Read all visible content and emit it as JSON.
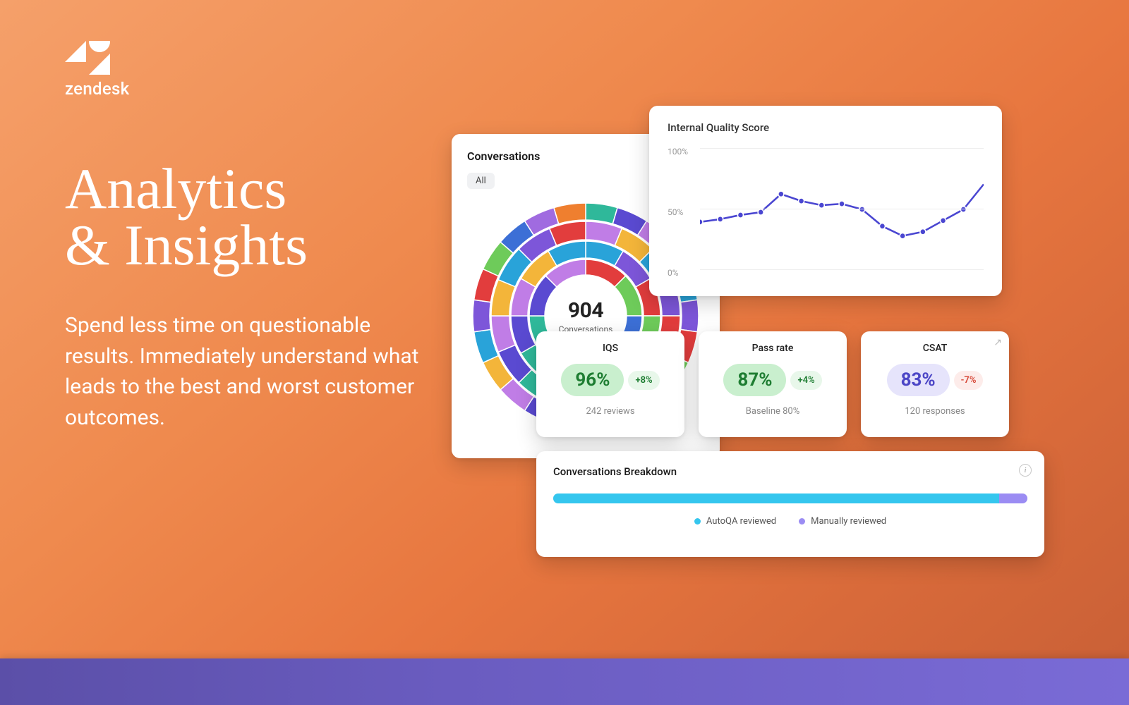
{
  "brand": {
    "name": "zendesk"
  },
  "hero": {
    "title_line1": "Analytics",
    "title_line2": "& Insights",
    "subhead": "Spend less time on questionable results. Immediately understand what leads to the best and worst customer outcomes."
  },
  "conversations_card": {
    "title": "Conversations",
    "filter_chip": "All",
    "center_value": "904",
    "center_label": "Conversations"
  },
  "iqs_card": {
    "title": "Internal Quality Score"
  },
  "kpis": {
    "iqs": {
      "title": "IQS",
      "value": "96%",
      "delta": "+8%",
      "sub": "242 reviews"
    },
    "pass": {
      "title": "Pass rate",
      "value": "87%",
      "delta": "+4%",
      "sub": "Baseline 80%"
    },
    "csat": {
      "title": "CSAT",
      "value": "83%",
      "delta": "-7%",
      "sub": "120 responses"
    }
  },
  "breakdown_card": {
    "title": "Conversations Breakdown",
    "legend_auto": "AutoQA reviewed",
    "legend_manual": "Manually reviewed"
  },
  "colors": {
    "cyan": "#35c6ee",
    "violet": "#9b8cf3",
    "line": "#4a46d1"
  },
  "chart_data": [
    {
      "id": "internal_quality_score",
      "type": "line",
      "title": "Internal Quality Score",
      "xlabel": "",
      "ylabel": "",
      "y_ticks": [
        "100%",
        "50%",
        "0%"
      ],
      "ylim": [
        0,
        100
      ],
      "x": [
        0,
        1,
        2,
        3,
        4,
        5,
        6,
        7,
        8,
        9,
        10,
        11,
        12,
        13
      ],
      "values": [
        43,
        45,
        48,
        50,
        63,
        58,
        55,
        56,
        52,
        40,
        33,
        36,
        44,
        52,
        70
      ],
      "grid": true,
      "legend": false
    },
    {
      "id": "conversations_sunburst",
      "type": "pie",
      "title": "Conversations",
      "note": "multi-ring sunburst; per-slice values not labeled in image",
      "center_value": 904,
      "center_label": "Conversations",
      "rings": 4
    },
    {
      "id": "conversations_breakdown",
      "type": "bar",
      "title": "Conversations Breakdown",
      "orientation": "horizontal-stacked",
      "categories": [
        "reviewed"
      ],
      "series": [
        {
          "name": "AutoQA reviewed",
          "values": [
            94
          ],
          "color": "#35c6ee"
        },
        {
          "name": "Manually reviewed",
          "values": [
            6
          ],
          "color": "#9b8cf3"
        }
      ],
      "ylim": [
        0,
        100
      ]
    }
  ]
}
